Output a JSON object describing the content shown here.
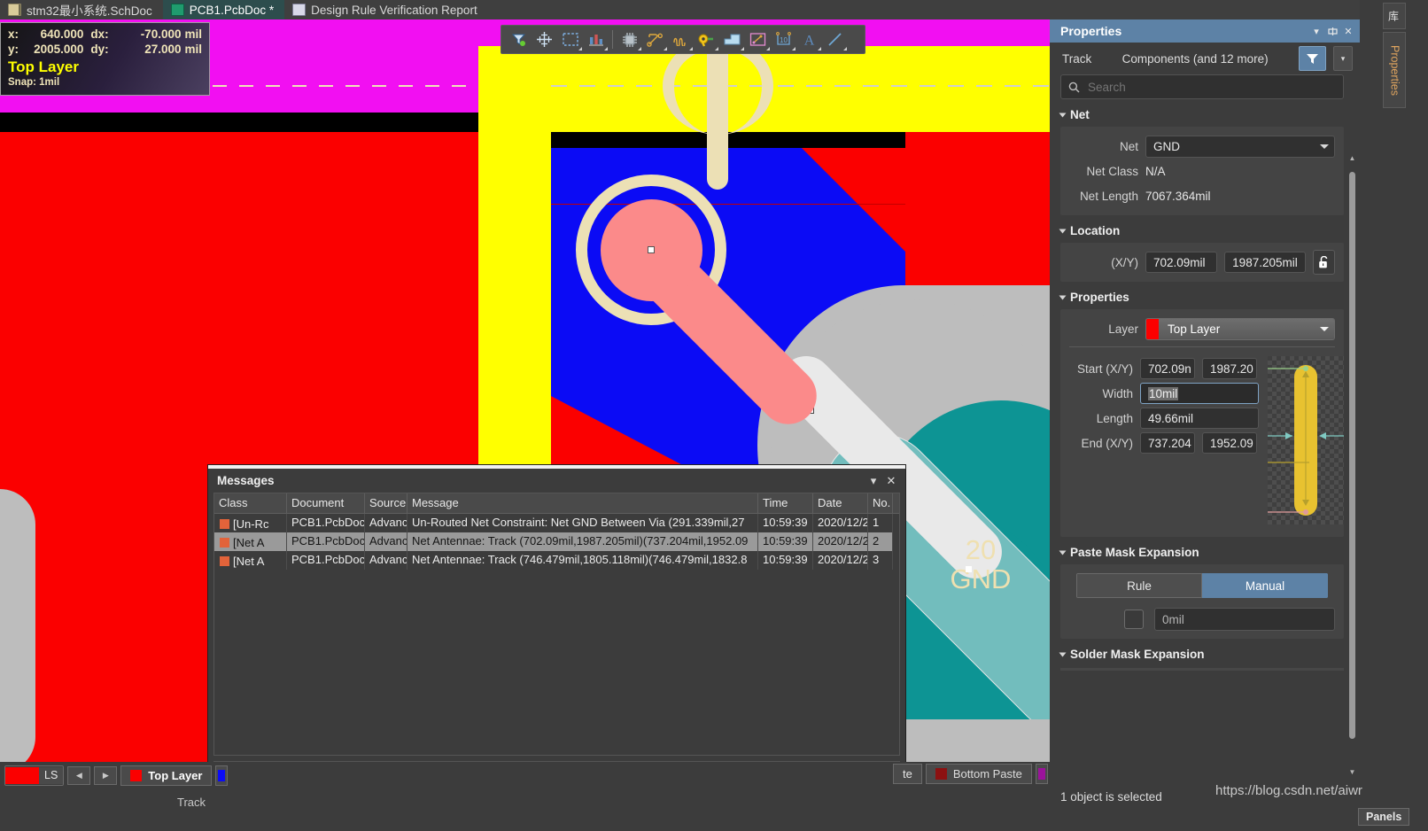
{
  "tabs": [
    {
      "label": "stm32最小系统.SchDoc",
      "icon": "schematic-icon",
      "active": false
    },
    {
      "label": "PCB1.PcbDoc *",
      "icon": "pcb-icon",
      "active": true
    },
    {
      "label": "Design Rule Verification Report",
      "icon": "report-icon",
      "active": false
    }
  ],
  "tabbar_overflow": "库",
  "hud": {
    "x_key": "x:",
    "x_val": "640.000",
    "dx_key": "dx:",
    "dx_val": "-70.000",
    "dx_unit": "mil",
    "y_key": "y:",
    "y_val": "2005.000",
    "dy_key": "dy:",
    "dy_val": "27.000",
    "dy_unit": "mil",
    "layer": "Top Layer",
    "snap": "Snap: 1mil"
  },
  "toolbar": {
    "items": [
      {
        "name": "filter-selection-icon"
      },
      {
        "name": "crosshair-place-icon"
      },
      {
        "name": "rectangle-select-icon"
      },
      {
        "name": "bar-chart-icon"
      },
      {
        "name": "component-ic-icon"
      },
      {
        "name": "route-track-icon"
      },
      {
        "name": "differential-pair-icon"
      },
      {
        "name": "via-pad-icon"
      },
      {
        "name": "polygon-pour-icon"
      },
      {
        "name": "dimension-line-icon"
      },
      {
        "name": "coordinate-icon"
      },
      {
        "name": "text-string-icon"
      },
      {
        "name": "line-icon"
      }
    ]
  },
  "canvas": {
    "pad_label_line1": "20",
    "pad_label_line2": "GND"
  },
  "messages": {
    "title": "Messages",
    "collapse_icon": "chevron-down-icon",
    "close_icon": "close-icon",
    "columns": [
      "Class",
      "Document",
      "Source",
      "Message",
      "Time",
      "Date",
      "No."
    ],
    "rows": [
      {
        "class": "[Un-Rc",
        "document": "PCB1.PcbDoc",
        "source": "Advanc",
        "message": "Un-Routed Net Constraint: Net GND Between Via (291.339mil,27",
        "time": "10:59:39",
        "date": "2020/12/2",
        "no": "1",
        "selected": false
      },
      {
        "class": "[Net A",
        "document": "PCB1.PcbDoc",
        "source": "Advanc",
        "message": "Net Antennae: Track (702.09mil,1987.205mil)(737.204mil,1952.09",
        "time": "10:59:39",
        "date": "2020/12/2",
        "no": "2",
        "selected": true
      },
      {
        "class": "[Net A",
        "document": "PCB1.PcbDoc",
        "source": "Advanc",
        "message": "Net Antennae: Track (746.479mil,1805.118mil)(746.479mil,1832.8",
        "time": "10:59:39",
        "date": "2020/12/2",
        "no": "3",
        "selected": false
      }
    ]
  },
  "properties": {
    "title": "Properties",
    "header_icons": [
      "chevron-down-icon",
      "dock-icon",
      "close-icon"
    ],
    "object_type": "Track",
    "object_scope": "Components (and 12 more)",
    "filter_icon": "funnel-icon",
    "filter_dropdown_icon": "chevron-down-icon",
    "search": {
      "placeholder": "Search",
      "value": "",
      "icon": "search-icon"
    },
    "net": {
      "section": "Net",
      "net_label": "Net",
      "net_value": "GND",
      "net_class_label": "Net Class",
      "net_class_value": "N/A",
      "net_length_label": "Net Length",
      "net_length_value": "7067.364mil"
    },
    "location": {
      "section": "Location",
      "xy_label": "(X/Y)",
      "x_value": "702.09mil",
      "y_value": "1987.205mil",
      "lock_icon": "unlock-icon"
    },
    "props": {
      "section": "Properties",
      "layer_label": "Layer",
      "layer_value": "Top Layer",
      "layer_color": "#fb0000",
      "start_label": "Start (X/Y)",
      "start_x": "702.09n",
      "start_y": "1987.20",
      "width_label": "Width",
      "width_value": "10mil",
      "length_label": "Length",
      "length_value": "49.66mil",
      "end_label": "End (X/Y)",
      "end_x": "737.204",
      "end_y": "1952.09"
    },
    "paste_mask": {
      "section": "Paste Mask Expansion",
      "rule_label": "Rule",
      "manual_label": "Manual",
      "active": "Manual",
      "value": "0mil",
      "checkbox_checked": false
    },
    "solder_mask": {
      "section": "Solder Mask Expansion"
    },
    "status": "1 object is selected"
  },
  "right_dock": {
    "tabs": [
      {
        "label": "库",
        "name": "library-vtab"
      },
      {
        "label": "Properties",
        "name": "properties-vtab"
      }
    ]
  },
  "layer_bar": {
    "ls_label": "LS",
    "ls_color": "#fb0000",
    "prev_icon": "chevron-left-icon",
    "next_icon": "chevron-right-icon",
    "layers": [
      {
        "label": "Top Layer",
        "color": "#fb0000",
        "active": true
      },
      {
        "label": "Bottom Paste",
        "color": "#8c1111",
        "active": false
      }
    ],
    "partial_label": "te"
  },
  "status_bar": {
    "object": "Track"
  },
  "watermark": "https://blog.csdn.net/aiwr",
  "panels_button": "Panels",
  "colors": {
    "accent": "#5d82a6",
    "panel_bg": "#3c3c3c",
    "field_bg": "#303030",
    "top_layer": "#fb0000",
    "bottom_layer": "#0b0bf5",
    "silkscreen": "#ece0b5",
    "multi_layer": "#ffff00",
    "keepout": "#f20ff2"
  }
}
